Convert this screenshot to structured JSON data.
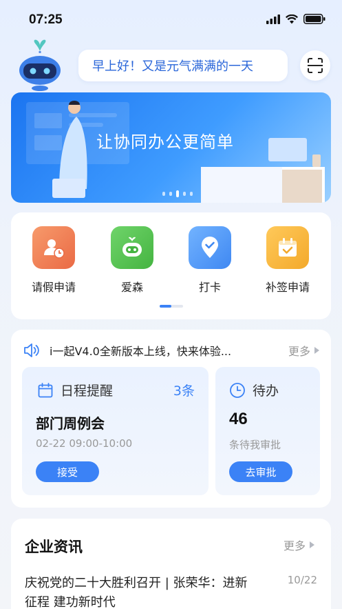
{
  "status_bar": {
    "time": "07:25"
  },
  "greeting": {
    "text": "早上好！又是元气满满的一天"
  },
  "banner": {
    "title": "让协同办公更简单",
    "slide_count": 5,
    "active_slide": 3
  },
  "quick_actions": [
    {
      "label": "请假申请",
      "icon": "leave-request-icon",
      "color": "#f07a4f"
    },
    {
      "label": "爱森",
      "icon": "robot-face-icon",
      "color": "#56c451"
    },
    {
      "label": "打卡",
      "icon": "location-check-icon",
      "color": "#4a97f8"
    },
    {
      "label": "补签申请",
      "icon": "calendar-check-icon",
      "color": "#f6b33b"
    }
  ],
  "notice": {
    "text": "i一起V4.0全新版本上线，快来体验...",
    "more_label": "更多"
  },
  "schedule": {
    "title": "日程提醒",
    "count": "3条",
    "event": "部门周例会",
    "time": "02-22  09:00-10:00",
    "button": "接受"
  },
  "todo": {
    "title": "待办",
    "number": "46",
    "subtitle": "条待我审批",
    "button": "去审批"
  },
  "news": {
    "title": "企业资讯",
    "more_label": "更多",
    "items": [
      {
        "text": "庆祝党的二十大胜利召开 | 张荣华：进新征程 建功新时代",
        "date": "10/22"
      }
    ]
  },
  "colors": {
    "accent": "#3b82f6",
    "greeting_text": "#2a66d9"
  }
}
